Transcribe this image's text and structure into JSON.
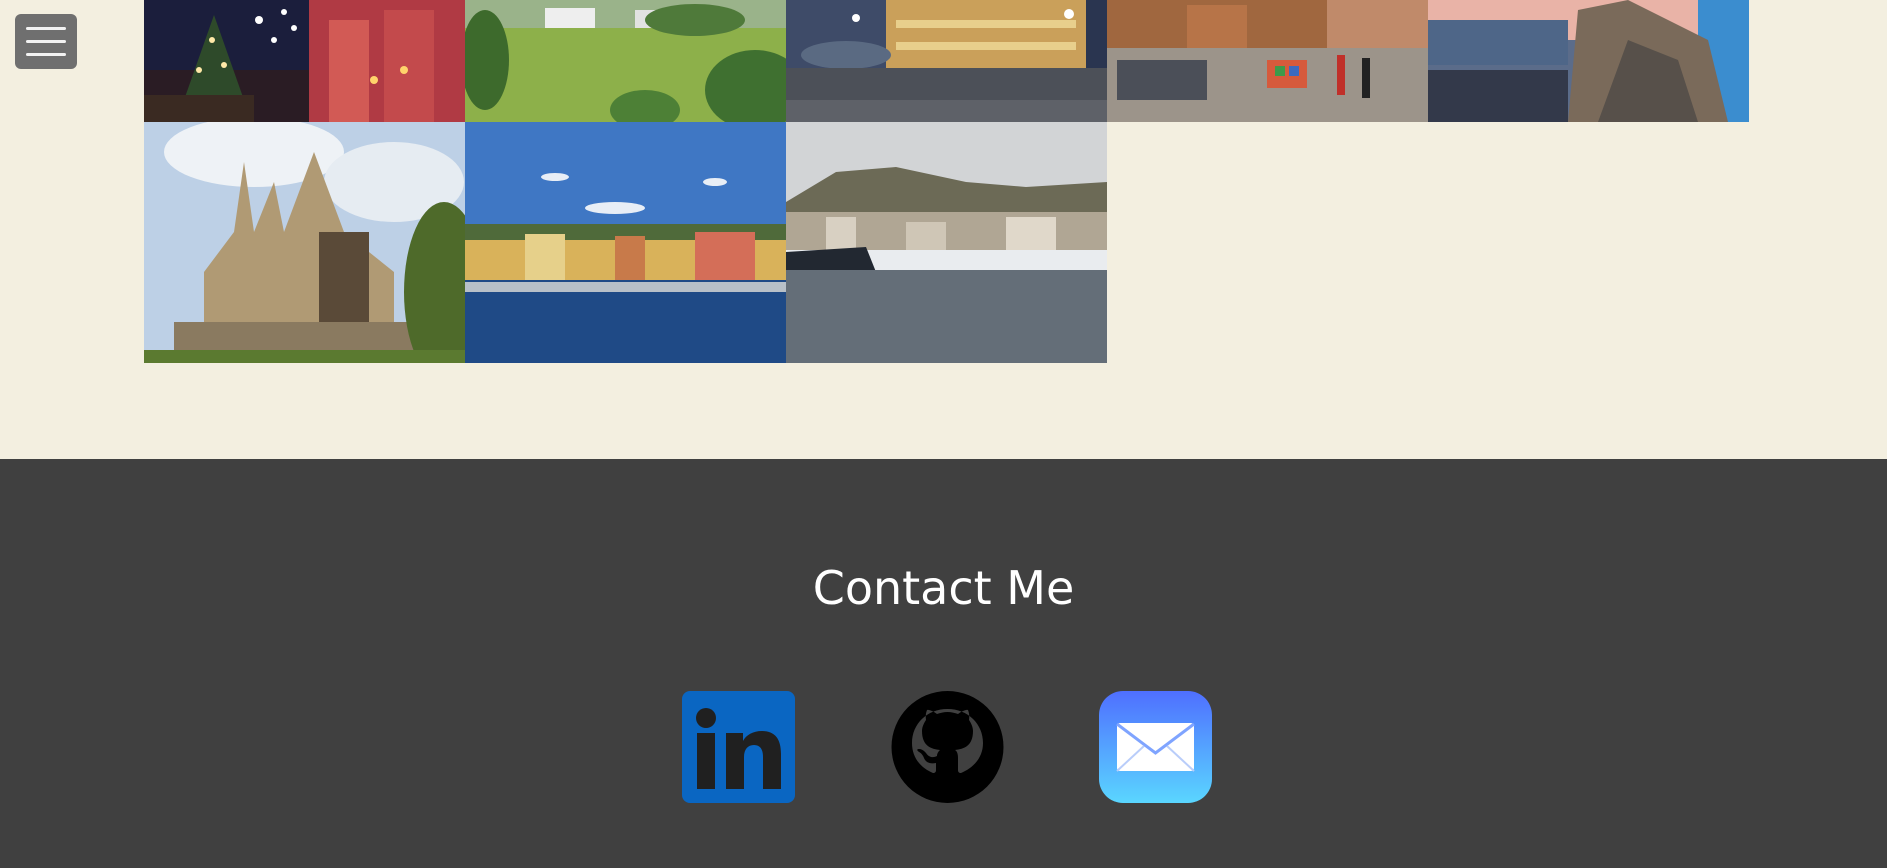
{
  "menu": {
    "icon": "hamburger-menu-icon"
  },
  "gallery": {
    "photos": [
      {
        "subject": "christmas-square-church"
      },
      {
        "subject": "park-lawn-palace"
      },
      {
        "subject": "night-fountain-piazza"
      },
      {
        "subject": "crowded-square-cafes"
      },
      {
        "subject": "coastal-rock-village"
      },
      {
        "subject": "gothic-chapel"
      },
      {
        "subject": "harbour-colourful-houses"
      },
      {
        "subject": "marina-yachts-mountains"
      }
    ]
  },
  "footer": {
    "title": "Contact Me",
    "links": [
      {
        "name": "linkedin",
        "icon": "linkedin-icon",
        "color": "#0a66c2"
      },
      {
        "name": "github",
        "icon": "github-icon",
        "color": "#000000"
      },
      {
        "name": "email",
        "icon": "mail-icon",
        "color": "#4ea8ff"
      }
    ]
  },
  "colors": {
    "page_background": "#f3efe0",
    "footer_background": "#404040",
    "menu_button": "#6f6f6f"
  }
}
